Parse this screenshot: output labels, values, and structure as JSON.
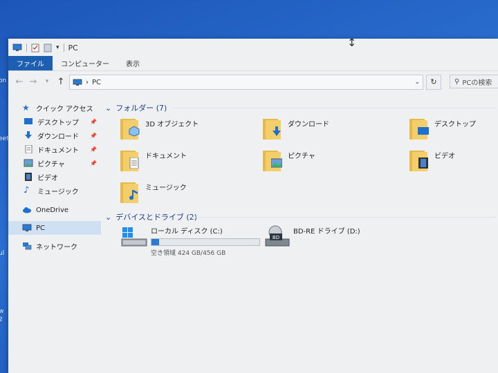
{
  "desktop": {
    "left_fragments": [
      "on",
      "eet",
      "ul",
      "w",
      "2"
    ]
  },
  "window": {
    "title": "PC",
    "ribbon_tabs": [
      {
        "label": "ファイル",
        "active": true
      },
      {
        "label": "コンピューター"
      },
      {
        "label": "表示"
      }
    ],
    "address": {
      "path": "PC"
    },
    "search_placeholder": "PCの検索"
  },
  "sidebar": {
    "quick_access": "クイック アクセス",
    "items": [
      {
        "label": "デスクトップ",
        "pinned": true,
        "icon": "desktop-icon"
      },
      {
        "label": "ダウンロード",
        "pinned": true,
        "icon": "download-icon"
      },
      {
        "label": "ドキュメント",
        "pinned": true,
        "icon": "document-icon"
      },
      {
        "label": "ピクチャ",
        "pinned": true,
        "icon": "picture-icon"
      },
      {
        "label": "ビデオ",
        "pinned": false,
        "icon": "video-icon"
      },
      {
        "label": "ミュージック",
        "pinned": false,
        "icon": "music-icon"
      }
    ],
    "onedrive": "OneDrive",
    "pc": "PC",
    "network": "ネットワーク"
  },
  "content": {
    "folders_header": "フォルダー (7)",
    "folders": [
      {
        "label": "3D オブジェクト",
        "icon": "3d-objects-icon"
      },
      {
        "label": "ダウンロード",
        "icon": "download-icon"
      },
      {
        "label": "デスクトップ",
        "icon": "desktop-icon"
      },
      {
        "label": "ドキュメント",
        "icon": "document-icon"
      },
      {
        "label": "ピクチャ",
        "icon": "picture-icon"
      },
      {
        "label": "ビデオ",
        "icon": "video-icon"
      },
      {
        "label": "ミュージック",
        "icon": "music-icon"
      }
    ],
    "devices_header": "デバイスとドライブ (2)",
    "drives": [
      {
        "label": "ローカル ディスク (C:)",
        "free_text": "空き領域 424 GB/456 GB",
        "used_fraction": 0.07,
        "icon": "hard-disk-icon"
      },
      {
        "label": "BD-RE ドライブ (D:)",
        "icon": "bd-drive-icon",
        "badge": "BD"
      }
    ]
  },
  "colors": {
    "accent": "#1c5fb3",
    "folder": "#f3cf6c",
    "desktop": "#1e5fc2"
  }
}
